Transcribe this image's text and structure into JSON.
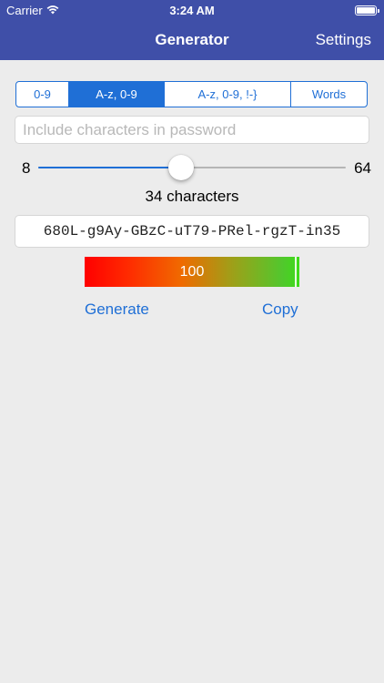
{
  "status_bar": {
    "carrier": "Carrier",
    "time": "3:24 AM",
    "battery_level": 1.0
  },
  "nav": {
    "title": "Generator",
    "settings_label": "Settings"
  },
  "segments": {
    "items": [
      "0-9",
      "A-z, 0-9",
      "A-z, 0-9, !-}",
      "Words"
    ],
    "selected_index": 1
  },
  "include_field": {
    "placeholder": "Include characters in password",
    "value": ""
  },
  "length_slider": {
    "min_label": "8",
    "max_label": "64",
    "min": 8,
    "max": 64,
    "value": 34,
    "value_label": "34 characters"
  },
  "password": "680L-g9Ay-GBzC-uT79-PRel-rgzT-in35",
  "strength": {
    "score_label": "100",
    "score": 100
  },
  "actions": {
    "generate_label": "Generate",
    "copy_label": "Copy"
  },
  "colors": {
    "bar": "#3f4fa8",
    "accent": "#1f6fd6",
    "background": "#ececec"
  }
}
